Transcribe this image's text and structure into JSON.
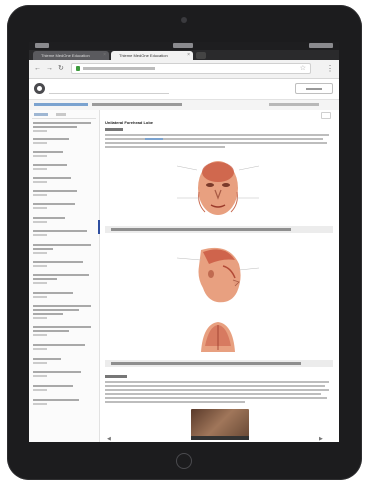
{
  "browser": {
    "tabs": [
      {
        "label": "Thieme MedOne Education",
        "active": false
      },
      {
        "label": "Thieme MedOne Education",
        "active": true
      }
    ],
    "url": ""
  },
  "icons": {
    "back": "back-arrow-icon",
    "forward": "forward-arrow-icon",
    "reload": "reload-icon",
    "lock": "lock-icon",
    "star": "star-icon",
    "menu": "menu-icon",
    "logo": "logo-icon"
  },
  "site": {
    "search_placeholder": "",
    "header_button": ""
  },
  "article": {
    "title": "Unilateral Forehead Lobe"
  },
  "colors": {
    "device": "#1c1c1e",
    "link": "#7aa2cf",
    "accent_indicator": "#2f4fa0",
    "secure_lock": "#3c9a3c"
  }
}
